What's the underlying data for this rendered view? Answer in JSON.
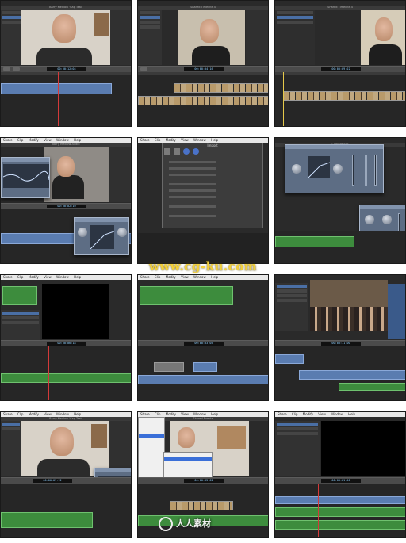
{
  "menu": [
    "Share",
    "Clip",
    "Modify",
    "View",
    "Window",
    "Help"
  ],
  "window_titles": {
    "t1": "Barry Medlow 'Cap Test'",
    "t2": "Shared Timeline 4",
    "t5": "Barry Medlow Audio",
    "t6": "Import",
    "t7": "Compressor",
    "t10": "Project Timeline",
    "t11": "Shared Events",
    "t13": "Barry Medlow 'Cap Test'",
    "t14": "Barry Medlow"
  },
  "timecodes": {
    "t1": "00:00:12:04",
    "t2": "00:00:04:16",
    "t3": "00:00:09:22",
    "t4": "00:00:02:10",
    "t7": "00:00:06:18",
    "t8": "00:00:03:05",
    "t9": "00:00:11:00",
    "t10": "00:00:07:12",
    "t11": "00:00:05:02",
    "t12": "00:00:01:20",
    "t13": "00:00:12:04",
    "t14": "00:00:08:11",
    "t15": "00:00:00:14"
  },
  "watermark": "www.cg-ku.com",
  "logo_text": "人人素材",
  "colors": {
    "ui_dark": "#2a2a2a",
    "clip_blue": "#5a7cb0",
    "clip_green": "#3d8c3d",
    "playhead": "#d43a3a",
    "plugin_panel": "#5d6d84",
    "watermark": "#f3d03a"
  }
}
